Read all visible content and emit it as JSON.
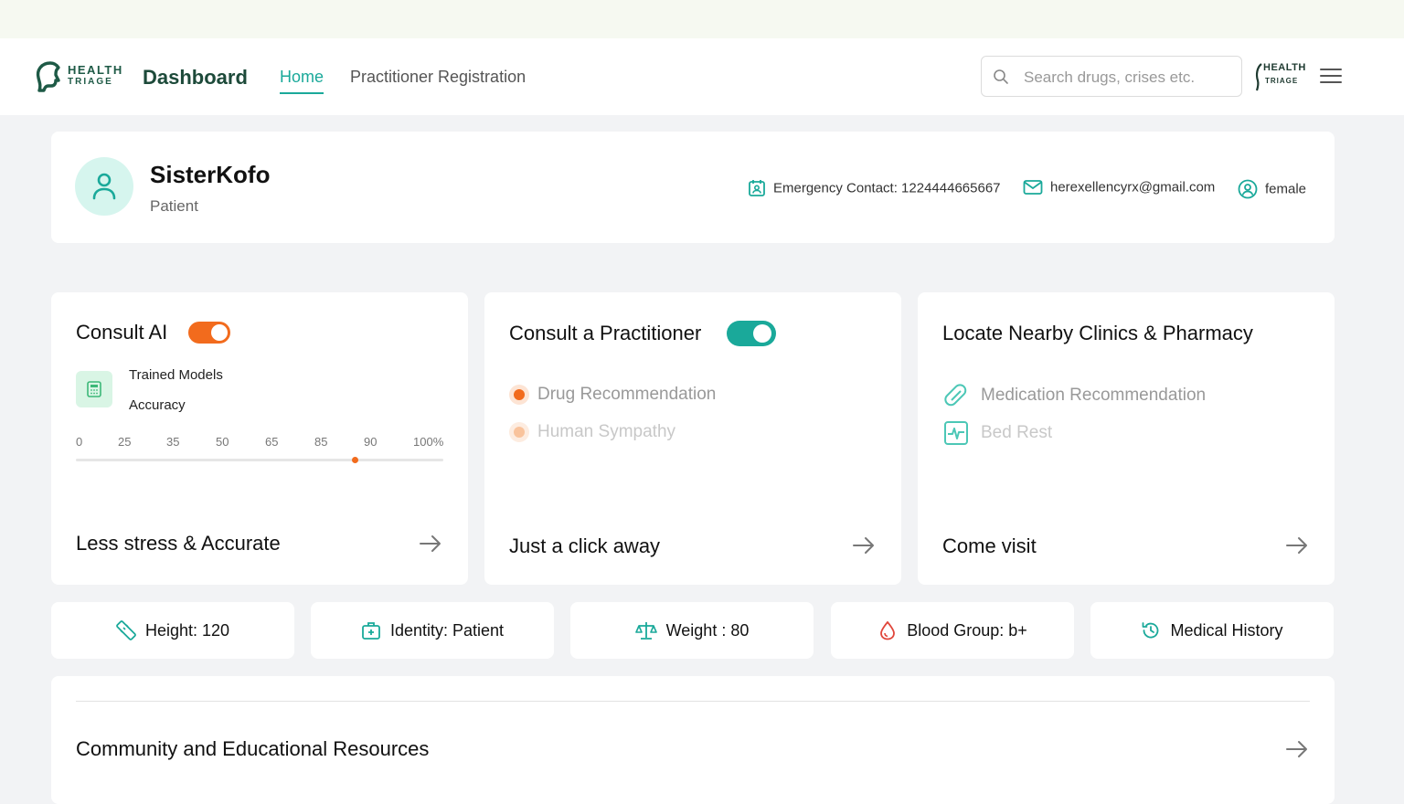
{
  "header": {
    "logo_line1": "HEALTH",
    "logo_line2": "TRIAGE",
    "title": "Dashboard",
    "nav": {
      "home": "Home",
      "practitioner_registration": "Practitioner Registration"
    },
    "search_placeholder": "Search drugs, crises etc.",
    "mini_logo_line1": "HEALTH",
    "mini_logo_line2": "TRIAGE"
  },
  "profile": {
    "name": "SisterKofo",
    "role": "Patient",
    "emergency_contact": "Emergency Contact: 1224444665667",
    "email": "herexellencyrx@gmail.com",
    "gender": "female"
  },
  "consult_ai": {
    "title": "Consult AI",
    "toggle_on": true,
    "toggle_color": "#f26b1d",
    "trained_models": "Trained Models",
    "accuracy_label": "Accuracy",
    "scale_ticks": [
      "0",
      "25",
      "35",
      "50",
      "65",
      "85",
      "90",
      "100%"
    ],
    "accuracy_value_percent": 76,
    "footer": "Less stress & Accurate"
  },
  "consult_practitioner": {
    "title": "Consult a Practitioner",
    "toggle_on": true,
    "toggle_color": "#1aa99a",
    "options": [
      "Drug Recommendation",
      "Human Sympathy"
    ],
    "footer": "Just a click away"
  },
  "locate": {
    "title": "Locate Nearby Clinics & Pharmacy",
    "options": [
      "Medication Recommendation",
      "Bed Rest"
    ],
    "footer": "Come visit"
  },
  "stats": {
    "height": "Height: 120",
    "identity": "Identity: Patient",
    "weight": "Weight : 80",
    "blood_group": "Blood Group: b+",
    "medical_history": "Medical History"
  },
  "community": {
    "title": "Community and Educational Resources"
  },
  "colors": {
    "accent_teal": "#1aa99a",
    "accent_orange": "#f26b1d",
    "brand_dark": "#1d4a3a"
  },
  "icons": [
    "search-icon",
    "menu-icon",
    "user-icon",
    "contact-card-icon",
    "mail-icon",
    "user-circle-icon",
    "calculator-icon",
    "arrow-right-icon",
    "pill-icon",
    "heart-pulse-icon",
    "ruler-icon",
    "medical-bag-icon",
    "scale-icon",
    "blood-drop-icon",
    "history-icon"
  ]
}
